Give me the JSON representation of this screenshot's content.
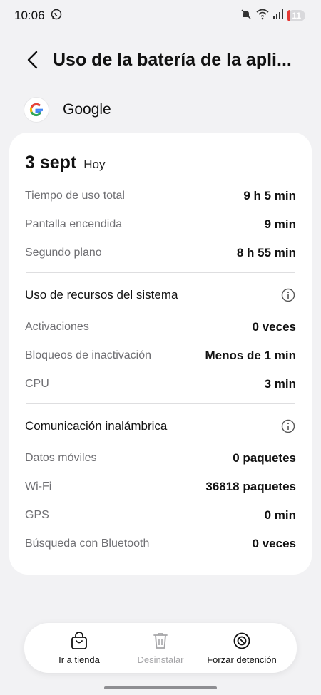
{
  "status_bar": {
    "time": "10:06",
    "battery_level": "11"
  },
  "header": {
    "title": "Uso de la batería de la apli..."
  },
  "app": {
    "name": "Google"
  },
  "card": {
    "date": "3 sept",
    "date_sub": "Hoy",
    "usage": [
      {
        "label": "Tiempo de uso total",
        "value": "9 h 5 min"
      },
      {
        "label": "Pantalla encendida",
        "value": "9 min"
      },
      {
        "label": "Segundo plano",
        "value": "8 h 55 min"
      }
    ],
    "system_section": {
      "title": "Uso de recursos del sistema",
      "rows": [
        {
          "label": "Activaciones",
          "value": "0 veces"
        },
        {
          "label": "Bloqueos de inactivación",
          "value": "Menos de 1 min"
        },
        {
          "label": "CPU",
          "value": "3 min"
        }
      ]
    },
    "wireless_section": {
      "title": "Comunicación inalámbrica",
      "rows": [
        {
          "label": "Datos móviles",
          "value": "0 paquetes"
        },
        {
          "label": "Wi-Fi",
          "value": "36818 paquetes"
        },
        {
          "label": "GPS",
          "value": "0 min"
        },
        {
          "label": "Búsqueda con Bluetooth",
          "value": "0 veces"
        }
      ]
    }
  },
  "actions": [
    {
      "label": "Ir a tienda",
      "icon": "shopping-bag-icon"
    },
    {
      "label": "Desinstalar",
      "icon": "trash-icon"
    },
    {
      "label": "Forzar detención",
      "icon": "block-icon"
    }
  ],
  "colors": {
    "background": "#f2f2f4",
    "card": "#ffffff",
    "muted_text": "#6f6f73",
    "disabled_text": "#a5a5a8",
    "battery_low": "#e53935"
  }
}
